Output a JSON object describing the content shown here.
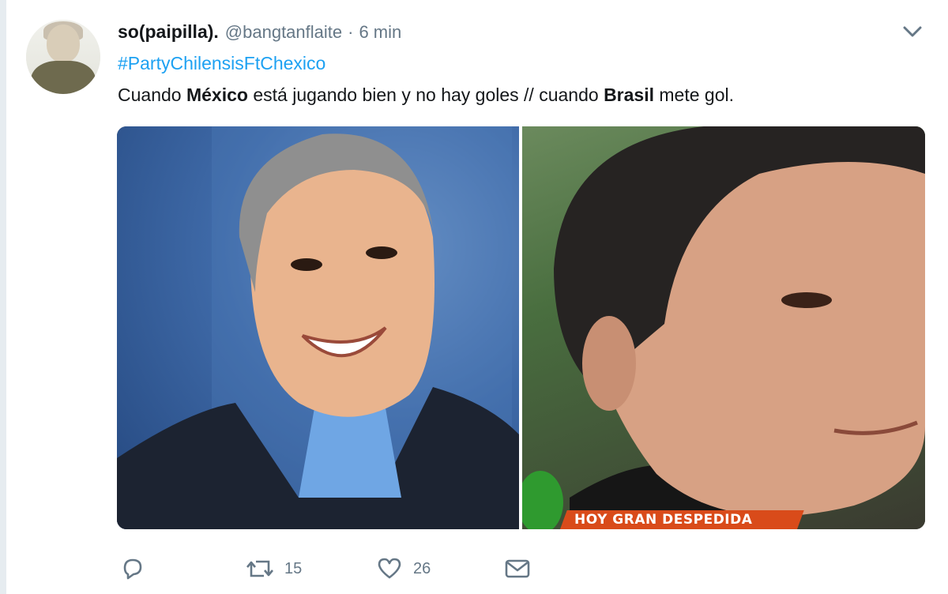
{
  "tweet": {
    "display_name": "so(paipilla).",
    "handle": "@bangtanflaite",
    "separator": "·",
    "timestamp": "6 min",
    "hashtag": "#PartyChilensisFtChexico",
    "text_parts": {
      "p1": "Cuando ",
      "b1": "México",
      "p2": " está jugando bien y no hay goles // cuando ",
      "b2": "Brasil",
      "p3": " mete gol."
    },
    "media": {
      "right_image_caption": "HOY GRAN DESPEDIDA"
    }
  },
  "actions": {
    "reply": {
      "icon": "reply-icon",
      "count": ""
    },
    "retweet": {
      "icon": "retweet-icon",
      "count": "15"
    },
    "like": {
      "icon": "heart-icon",
      "count": "26"
    },
    "dm": {
      "icon": "envelope-icon",
      "count": ""
    }
  },
  "colors": {
    "link": "#1da1f2",
    "muted": "#657786",
    "text": "#14171a",
    "banner": "#d94b1a"
  }
}
